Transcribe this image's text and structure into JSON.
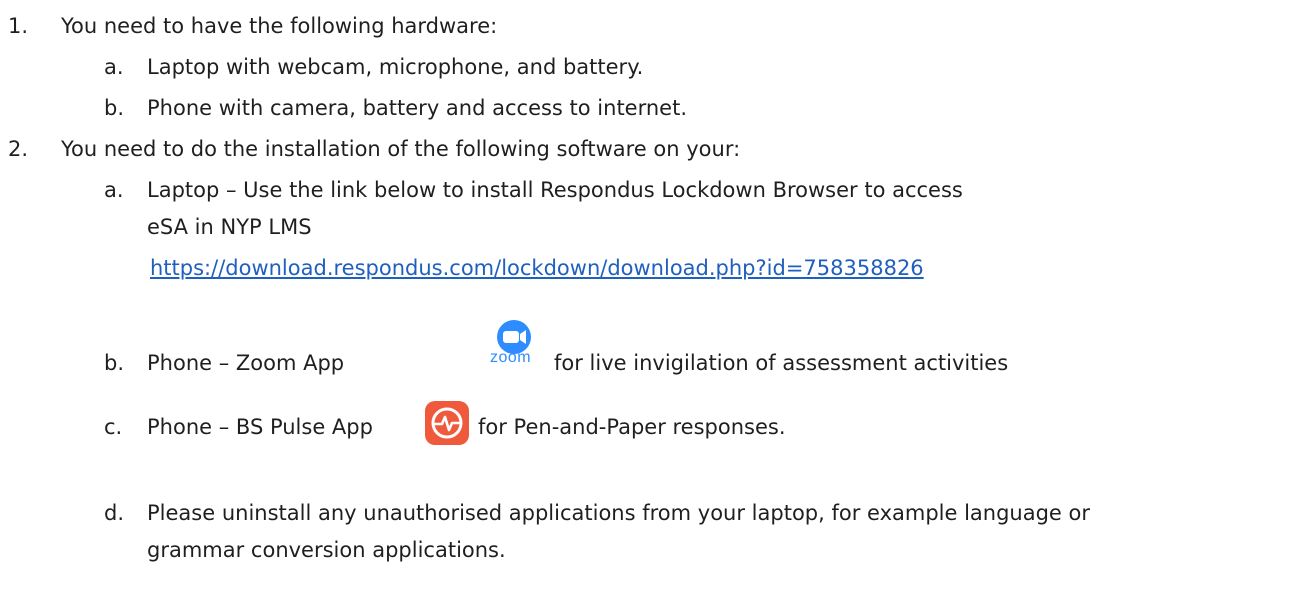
{
  "items": [
    {
      "number": "1.",
      "text": "You need to have the following hardware:",
      "subitems": [
        {
          "letter": "a.",
          "text": "Laptop with webcam, microphone, and battery."
        },
        {
          "letter": "b.",
          "text": "Phone with camera, battery and access to internet."
        }
      ]
    },
    {
      "number": "2.",
      "text": "You need to do the installation of the following software on your:",
      "subitems": [
        {
          "letter": "a.",
          "text_line1": "Laptop – Use the link below to install Respondus Lockdown Browser to access",
          "text_line2": "eSA in NYP LMS",
          "link": "https://download.respondus.com/lockdown/download.php?id=758358826"
        },
        {
          "letter": "b.",
          "text_before": "Phone – Zoom App",
          "text_after": "for live invigilation of assessment activities",
          "logo_text": "zoom",
          "icon": "zoom-app-icon"
        },
        {
          "letter": "c.",
          "text_before": "Phone – BS Pulse App",
          "text_after": "for Pen-and-Paper responses.",
          "icon": "bs-pulse-app-icon"
        },
        {
          "letter": "d.",
          "text_line1": "Please uninstall any unauthorised applications from your laptop, for example language or",
          "text_line2": "grammar conversion applications."
        }
      ]
    }
  ],
  "colors": {
    "text": "#1f1f1f",
    "link": "#1f5fbf",
    "zoom_blue": "#2d8cff",
    "pulse_orange": "#ef5a3c"
  }
}
